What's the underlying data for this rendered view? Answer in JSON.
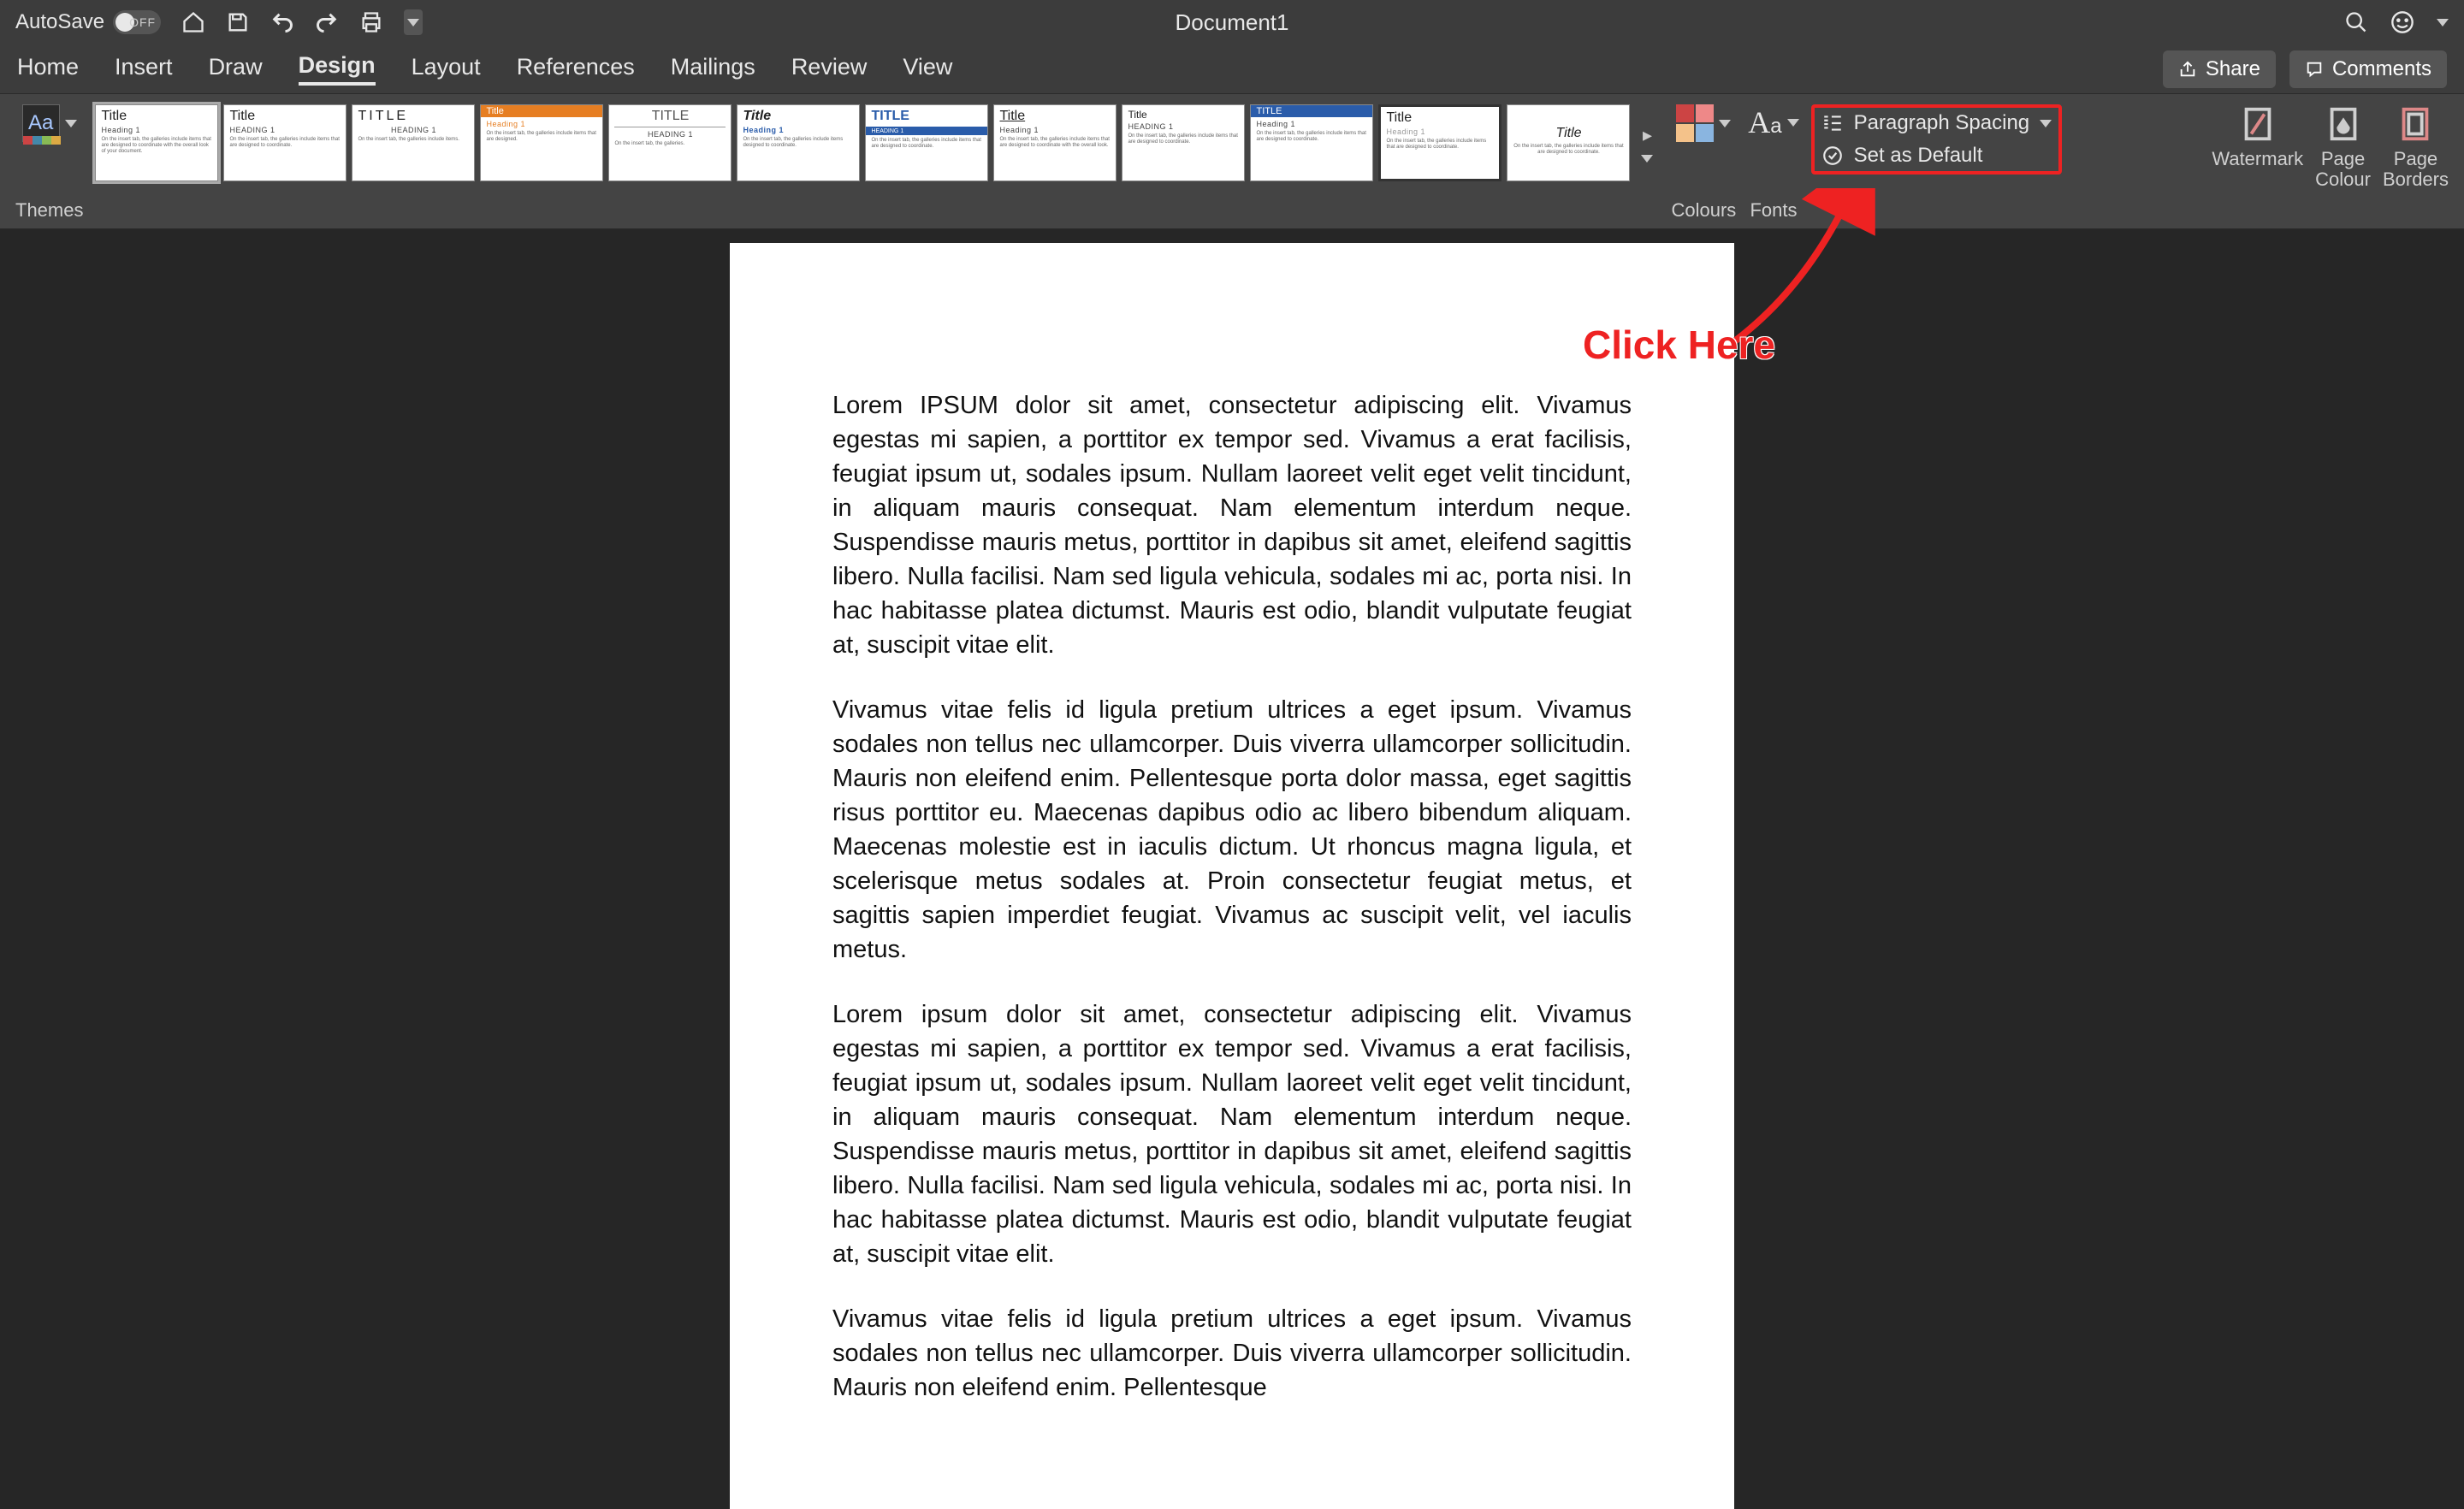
{
  "titlebar": {
    "autosave_label": "AutoSave",
    "autosave_state": "OFF",
    "document_name": "Document1"
  },
  "tabs": {
    "items": [
      "Home",
      "Insert",
      "Draw",
      "Design",
      "Layout",
      "References",
      "Mailings",
      "Review",
      "View"
    ],
    "active_index": 3,
    "share": "Share",
    "comments": "Comments"
  },
  "ribbon": {
    "themes_label": "Themes",
    "gallery": [
      {
        "title": "Title",
        "heading": "Heading 1",
        "style": "basic"
      },
      {
        "title": "Title",
        "heading": "HEADING 1",
        "style": "caps"
      },
      {
        "title": "TITLE",
        "heading": "HEADING 1",
        "style": "spaced"
      },
      {
        "title": "Title",
        "heading": "Heading 1",
        "style": "orange_bar"
      },
      {
        "title": "TITLE",
        "heading": "HEADING 1",
        "style": "center"
      },
      {
        "title": "Title",
        "heading": "Heading 1",
        "style": "blue_italic"
      },
      {
        "title": "TITLE",
        "heading": "HEADING 1",
        "style": "blue_bar"
      },
      {
        "title": "Title",
        "heading": "Heading 1",
        "style": "underline"
      },
      {
        "title": "Title",
        "heading": "HEADING 1",
        "style": "small"
      },
      {
        "title": "TITLE",
        "heading": "Heading 1",
        "style": "blue_head"
      },
      {
        "title": "Title",
        "heading": "Heading 1",
        "style": "border"
      },
      {
        "title": "Title",
        "heading": "",
        "style": "centered"
      }
    ],
    "colours_label": "Colours",
    "fonts_label": "Fonts",
    "paragraph_spacing": "Paragraph Spacing",
    "set_default": "Set as Default",
    "watermark": "Watermark",
    "page_colour": "Page\nColour",
    "page_borders": "Page\nBorders"
  },
  "annotation": {
    "text": "Click Here"
  },
  "document": {
    "paragraphs": [
      "Lorem IPSUM dolor sit amet, consectetur adipiscing elit. Vivamus egestas mi sapien, a porttitor ex tempor sed. Vivamus a erat facilisis, feugiat ipsum ut, sodales ipsum. Nullam laoreet velit eget velit tincidunt, in aliquam mauris consequat. Nam elementum interdum neque. Suspendisse mauris metus, porttitor in dapibus sit amet, eleifend sagittis libero. Nulla facilisi. Nam sed ligula vehicula, sodales mi ac, porta nisi. In hac habitasse platea dictumst. Mauris est odio, blandit vulputate feugiat at, suscipit vitae elit.",
      "Vivamus vitae felis id ligula pretium ultrices a eget ipsum. Vivamus sodales non tellus nec ullamcorper. Duis viverra ullamcorper sollicitudin. Mauris non eleifend enim. Pellentesque porta dolor massa, eget sagittis risus porttitor eu. Maecenas dapibus odio ac libero bibendum aliquam. Maecenas molestie est in iaculis dictum. Ut rhoncus magna ligula, et scelerisque metus sodales at. Proin consectetur feugiat metus, et sagittis sapien imperdiet feugiat. Vivamus ac suscipit velit, vel iaculis metus.",
      "Lorem ipsum dolor sit amet, consectetur adipiscing elit. Vivamus egestas mi sapien, a porttitor ex tempor sed. Vivamus a erat facilisis, feugiat ipsum ut, sodales ipsum. Nullam laoreet velit eget velit tincidunt, in aliquam mauris consequat. Nam elementum interdum neque. Suspendisse mauris metus, porttitor in dapibus sit amet, eleifend sagittis libero. Nulla facilisi. Nam sed ligula vehicula, sodales mi ac, porta nisi. In hac habitasse platea dictumst. Mauris est odio, blandit vulputate feugiat at, suscipit vitae elit.",
      "Vivamus vitae felis id ligula pretium ultrices a eget ipsum. Vivamus sodales non tellus nec ullamcorper. Duis viverra ullamcorper sollicitudin. Mauris non eleifend enim. Pellentesque"
    ]
  }
}
